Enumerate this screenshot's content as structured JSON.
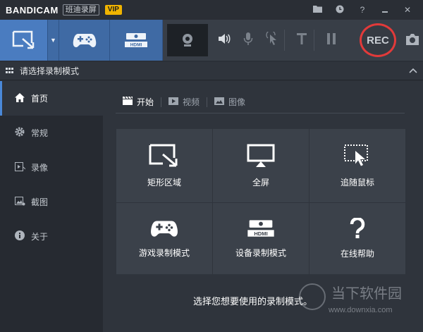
{
  "titlebar": {
    "brand": "BANDICAM",
    "brand_sub": "班迪录屏",
    "vip": "VIP",
    "icons": [
      "folder-icon",
      "clock-icon",
      "help-icon",
      "minimize-icon",
      "close-icon"
    ]
  },
  "toolbar": {
    "rec_label": "REC",
    "hdmi_label": "HDMI",
    "tools": [
      "webcam-icon",
      "speaker-icon",
      "microphone-icon",
      "cursor-click-icon",
      "text-icon",
      "pause-icon",
      "camera-icon"
    ]
  },
  "section": {
    "title": "请选择录制模式"
  },
  "sidebar": {
    "items": [
      {
        "label": "首页",
        "icon": "home-icon"
      },
      {
        "label": "常规",
        "icon": "gear-icon"
      },
      {
        "label": "录像",
        "icon": "video-icon"
      },
      {
        "label": "截图",
        "icon": "image-icon"
      },
      {
        "label": "关于",
        "icon": "info-icon"
      }
    ]
  },
  "tabs": [
    {
      "label": "开始",
      "icon": "clapper-icon"
    },
    {
      "label": "视频",
      "icon": "play-icon"
    },
    {
      "label": "图像",
      "icon": "image-icon"
    }
  ],
  "tiles": [
    {
      "label": "矩形区域",
      "icon": "rect-area-icon"
    },
    {
      "label": "全屏",
      "icon": "monitor-icon"
    },
    {
      "label": "追随鼠标",
      "icon": "follow-mouse-icon"
    },
    {
      "label": "游戏录制模式",
      "icon": "gamepad-icon"
    },
    {
      "label": "设备录制模式",
      "icon": "hdmi-icon"
    },
    {
      "label": "在线帮助",
      "icon": "question-icon"
    }
  ],
  "hint": "选择您想要使用的录制模式。",
  "watermark": {
    "text": "当下软件园",
    "url": "www.downxia.com"
  },
  "colors": {
    "accent": "#4a7cc0",
    "rec_ring": "#e23a3a",
    "vip": "#f0b400"
  }
}
